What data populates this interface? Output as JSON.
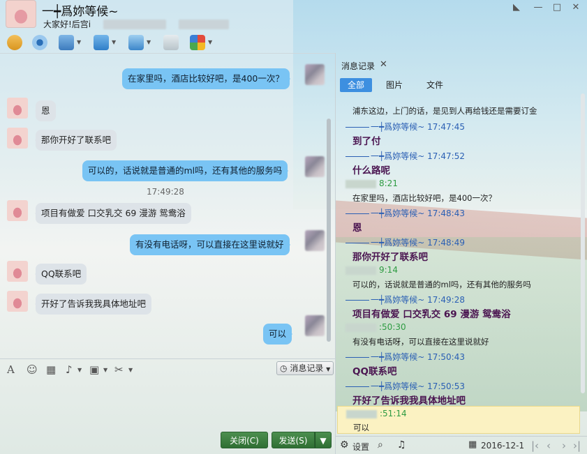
{
  "window": {
    "contact_name": "一┿爲妳等候~",
    "contact_signature": "大家好!后宫i"
  },
  "chat": {
    "messages": [
      {
        "side": "right",
        "text": "在家里吗，酒店比较好吧，是400一次？"
      },
      {
        "side": "left",
        "text": "恩"
      },
      {
        "side": "left",
        "text": "那你开好了联系吧"
      },
      {
        "side": "right",
        "text": "可以的，话说就是普通的ml吗，还有其他的服务吗"
      },
      {
        "side": "time",
        "text": "17:49:28"
      },
      {
        "side": "left",
        "text": "项目有做爱 口交乳交 69 漫游 鸳鸯浴"
      },
      {
        "side": "right",
        "text": "有没有电话呀，可以直接在这里说就好"
      },
      {
        "side": "left",
        "text": "QQ联系吧"
      },
      {
        "side": "left",
        "text": "开好了告诉我我具体地址吧"
      },
      {
        "side": "right",
        "text": "可以"
      }
    ],
    "history_button": "消息记录",
    "close_button": "关闭(C)",
    "send_button": "发送(S)"
  },
  "history_panel": {
    "tab_title": "消息记录",
    "filters": [
      "全部",
      "图片",
      "文件"
    ],
    "records": [
      {
        "type": "msg",
        "text": "浦东这边，上门的话，是见到人再给钱还是需要订金"
      },
      {
        "type": "sender",
        "text": "一┿爲妳等候~ 17:47:45"
      },
      {
        "type": "bold",
        "text": "到了付"
      },
      {
        "type": "sender",
        "text": "一┿爲妳等候~ 17:47:52"
      },
      {
        "type": "bold",
        "text": "什么路呢"
      },
      {
        "type": "green",
        "text": "8:21"
      },
      {
        "type": "msg",
        "text": "在家里吗，酒店比较好吧，是400一次？"
      },
      {
        "type": "sender",
        "text": "一┿爲妳等候~ 17:48:43"
      },
      {
        "type": "bold",
        "text": "恩"
      },
      {
        "type": "sender",
        "text": "一┿爲妳等候~ 17:48:49"
      },
      {
        "type": "bold",
        "text": "那你开好了联系吧"
      },
      {
        "type": "green",
        "text": "9:14"
      },
      {
        "type": "msg",
        "text": "可以的，话说就是普通的ml吗，还有其他的服务吗"
      },
      {
        "type": "sender",
        "text": "一┿爲妳等候~ 17:49:28"
      },
      {
        "type": "bold",
        "text": "项目有做爱 口交乳交 69 漫游 鸳鸯浴"
      },
      {
        "type": "green",
        "text": ":50:30"
      },
      {
        "type": "msg",
        "text": "有没有电话呀，可以直接在这里说就好"
      },
      {
        "type": "sender",
        "text": "一┿爲妳等候~ 17:50:43"
      },
      {
        "type": "bold",
        "text": "QQ联系吧"
      },
      {
        "type": "sender",
        "text": "一┿爲妳等候~ 17:50:53"
      },
      {
        "type": "bold",
        "text": "开好了告诉我我具体地址吧"
      },
      {
        "type": "green",
        "text": ":51:14"
      },
      {
        "type": "msg",
        "text": "可以"
      }
    ],
    "footer": {
      "settings_label": "设置",
      "date": "2016-12-1"
    }
  }
}
